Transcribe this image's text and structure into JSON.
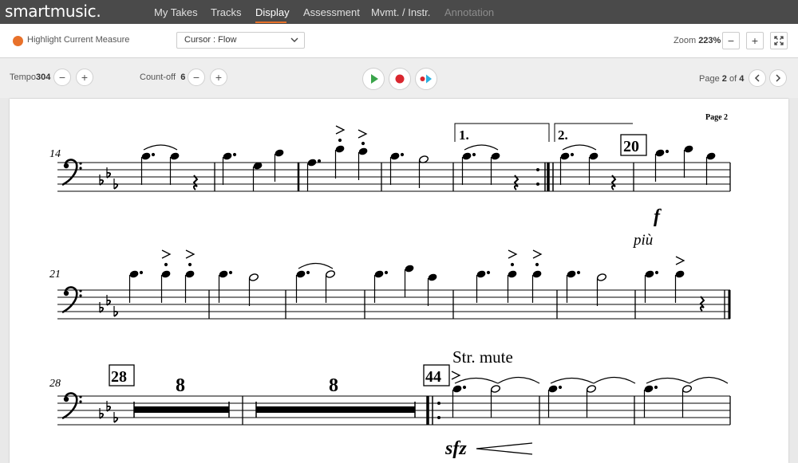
{
  "app": {
    "logo": "smartmusic."
  },
  "nav": {
    "items": [
      "My Takes",
      "Tracks",
      "Display",
      "Assessment",
      "Mvmt. / Instr.",
      "Annotation"
    ],
    "active": "Display",
    "disabled": "Annotation"
  },
  "toolbar": {
    "highlight_label": "Highlight Current Measure",
    "cursor_value": "Cursor : Flow",
    "zoom_label": "Zoom",
    "zoom_value": "223%",
    "zoom_minus": "−",
    "zoom_plus": "+"
  },
  "controls": {
    "tempo_label": "Tempo",
    "tempo_value": "304",
    "countoff_label": "Count-off",
    "countoff_value": "6",
    "minus": "−",
    "plus": "+",
    "page_label": "Page",
    "page_current": "2",
    "page_of": "of",
    "page_total": "4"
  },
  "score": {
    "page_header": "Page 2",
    "systems": [
      {
        "start_measure": "14",
        "rehearsal": "20",
        "dynamics": [
          "f",
          "più"
        ],
        "endings": [
          "1.",
          "2."
        ]
      },
      {
        "start_measure": "21"
      },
      {
        "start_measure": "28",
        "rehearsals": [
          "28",
          "44"
        ],
        "multirests": [
          "8",
          "8"
        ],
        "technique": "Str. mute",
        "dynamic": "sfz"
      }
    ]
  },
  "colors": {
    "accent": "#e8712a",
    "nav_bg": "#4a4a4a",
    "play": "#3aa44a",
    "record": "#d9262e",
    "loop": "#2ab0e0"
  },
  "icons": [
    "chevron-down-icon",
    "fullscreen-icon",
    "play-icon",
    "record-icon",
    "play-from-record-icon",
    "chevron-left-icon",
    "chevron-right-icon"
  ]
}
